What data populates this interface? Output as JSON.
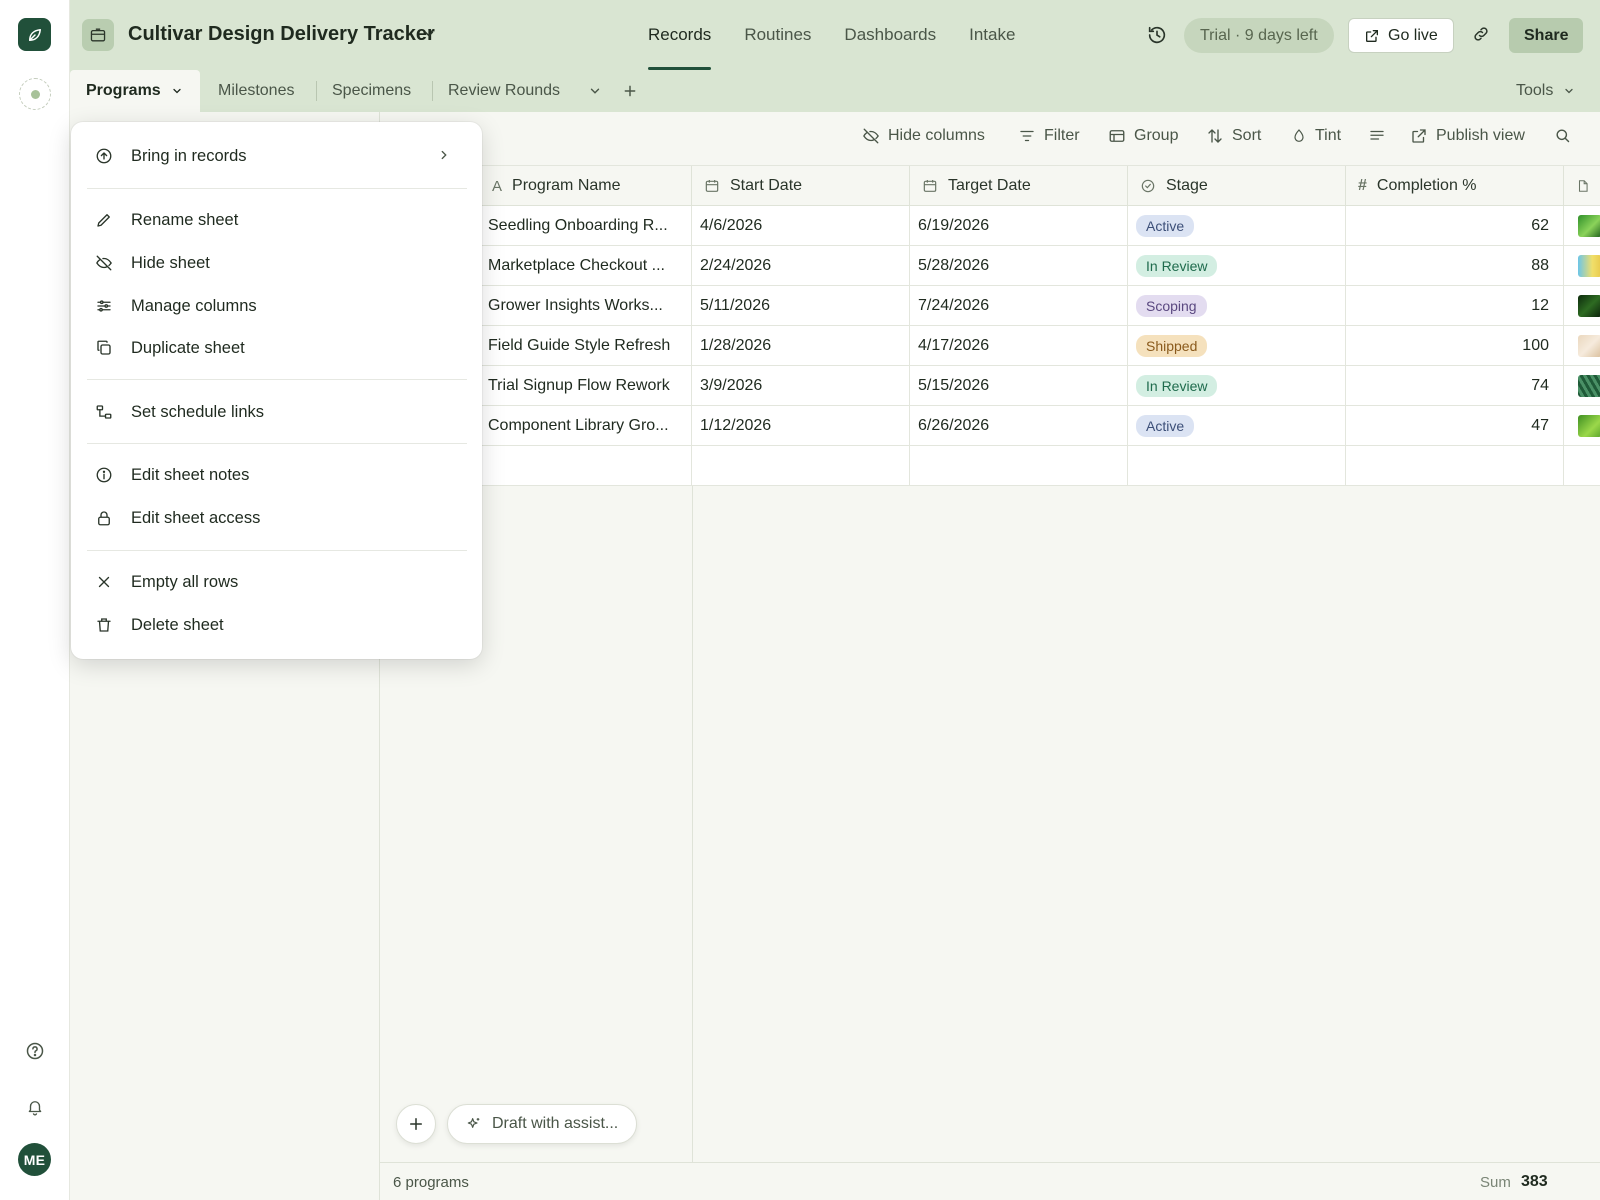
{
  "header": {
    "base_name": "Cultivar Design Delivery Tracker",
    "nav": [
      "Records",
      "Routines",
      "Dashboards",
      "Intake"
    ],
    "active_nav": "Records",
    "trial": "Trial · 9 days left",
    "go_live": "Go live",
    "share": "Share"
  },
  "tabs": {
    "items": [
      "Programs",
      "Milestones",
      "Specimens",
      "Review Rounds"
    ],
    "active": "Programs",
    "tools": "Tools"
  },
  "toolbar": {
    "hide_columns": "Hide columns",
    "filter": "Filter",
    "group": "Group",
    "sort": "Sort",
    "tint": "Tint",
    "publish": "Publish view"
  },
  "grid": {
    "columns": [
      "Program Name",
      "Start Date",
      "Target Date",
      "Stage",
      "Completion %"
    ],
    "rows": [
      {
        "name": "Seedling Onboarding R...",
        "start": "4/6/2026",
        "target": "6/19/2026",
        "stage": "Active",
        "completion": "62"
      },
      {
        "name": "Marketplace Checkout ...",
        "start": "2/24/2026",
        "target": "5/28/2026",
        "stage": "In Review",
        "completion": "88"
      },
      {
        "name": "Grower Insights Works...",
        "start": "5/11/2026",
        "target": "7/24/2026",
        "stage": "Scoping",
        "completion": "12"
      },
      {
        "name": "Field Guide Style Refresh",
        "start": "1/28/2026",
        "target": "4/17/2026",
        "stage": "Shipped",
        "completion": "100"
      },
      {
        "name": "Trial Signup Flow Rework",
        "start": "3/9/2026",
        "target": "5/15/2026",
        "stage": "In Review",
        "completion": "74"
      },
      {
        "name": "Component Library Gro...",
        "start": "1/12/2026",
        "target": "6/26/2026",
        "stage": "Active",
        "completion": "47"
      }
    ]
  },
  "assist": {
    "placeholder": "Draft with assist..."
  },
  "footer": {
    "count": "6 programs",
    "sum_label": "Sum",
    "sum": "383"
  },
  "menu": {
    "bring_in": "Bring in records",
    "rename": "Rename sheet",
    "hide": "Hide sheet",
    "manage_columns": "Manage columns",
    "duplicate": "Duplicate sheet",
    "schedule_links": "Set schedule links",
    "edit_notes": "Edit sheet notes",
    "edit_access": "Edit sheet access",
    "empty_rows": "Empty all rows",
    "delete": "Delete sheet"
  },
  "user": {
    "initials": "ME"
  },
  "colors": {
    "brand": "#21503a",
    "header_bg": "#d9e5d2",
    "share_bg": "#b7cbae"
  }
}
